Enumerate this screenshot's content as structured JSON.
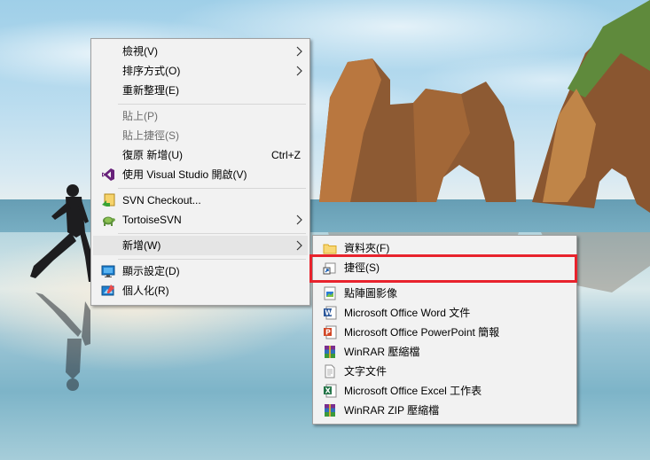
{
  "main_menu": {
    "items": [
      {
        "label": "檢視(V)",
        "has_submenu": true
      },
      {
        "label": "排序方式(O)",
        "has_submenu": true
      },
      {
        "label": "重新整理(E)"
      },
      {
        "label": "貼上(P)",
        "disabled": true
      },
      {
        "label": "貼上捷徑(S)",
        "disabled": true
      },
      {
        "label": "復原 新增(U)",
        "shortcut": "Ctrl+Z"
      },
      {
        "label": "使用 Visual Studio 開啟(V)",
        "icon": "visual-studio-icon"
      },
      {
        "label": "SVN Checkout...",
        "icon": "svn-checkout-icon"
      },
      {
        "label": "TortoiseSVN",
        "icon": "tortoisesvn-icon",
        "has_submenu": true
      },
      {
        "label": "新增(W)",
        "has_submenu": true,
        "highlighted": true
      },
      {
        "label": "顯示設定(D)",
        "icon": "display-settings-icon"
      },
      {
        "label": "個人化(R)",
        "icon": "personalize-icon"
      }
    ]
  },
  "new_submenu": {
    "items": [
      {
        "label": "資料夾(F)",
        "icon": "folder-icon"
      },
      {
        "label": "捷徑(S)",
        "icon": "shortcut-icon",
        "highlighted_box": true
      },
      {
        "label": "點陣圖影像",
        "icon": "bitmap-icon"
      },
      {
        "label": "Microsoft Office Word 文件",
        "icon": "word-icon"
      },
      {
        "label": "Microsoft Office PowerPoint 簡報",
        "icon": "powerpoint-icon"
      },
      {
        "label": "WinRAR 壓縮檔",
        "icon": "winrar-icon"
      },
      {
        "label": "文字文件",
        "icon": "text-document-icon"
      },
      {
        "label": "Microsoft Office Excel 工作表",
        "icon": "excel-icon"
      },
      {
        "label": "WinRAR ZIP 壓縮檔",
        "icon": "winrar-zip-icon"
      }
    ]
  },
  "colors": {
    "menu_background": "#f2f2f2",
    "menu_highlight": "#e5e5e5",
    "annotation_box": "#e8232d",
    "disabled_text": "#6d6d6d"
  }
}
